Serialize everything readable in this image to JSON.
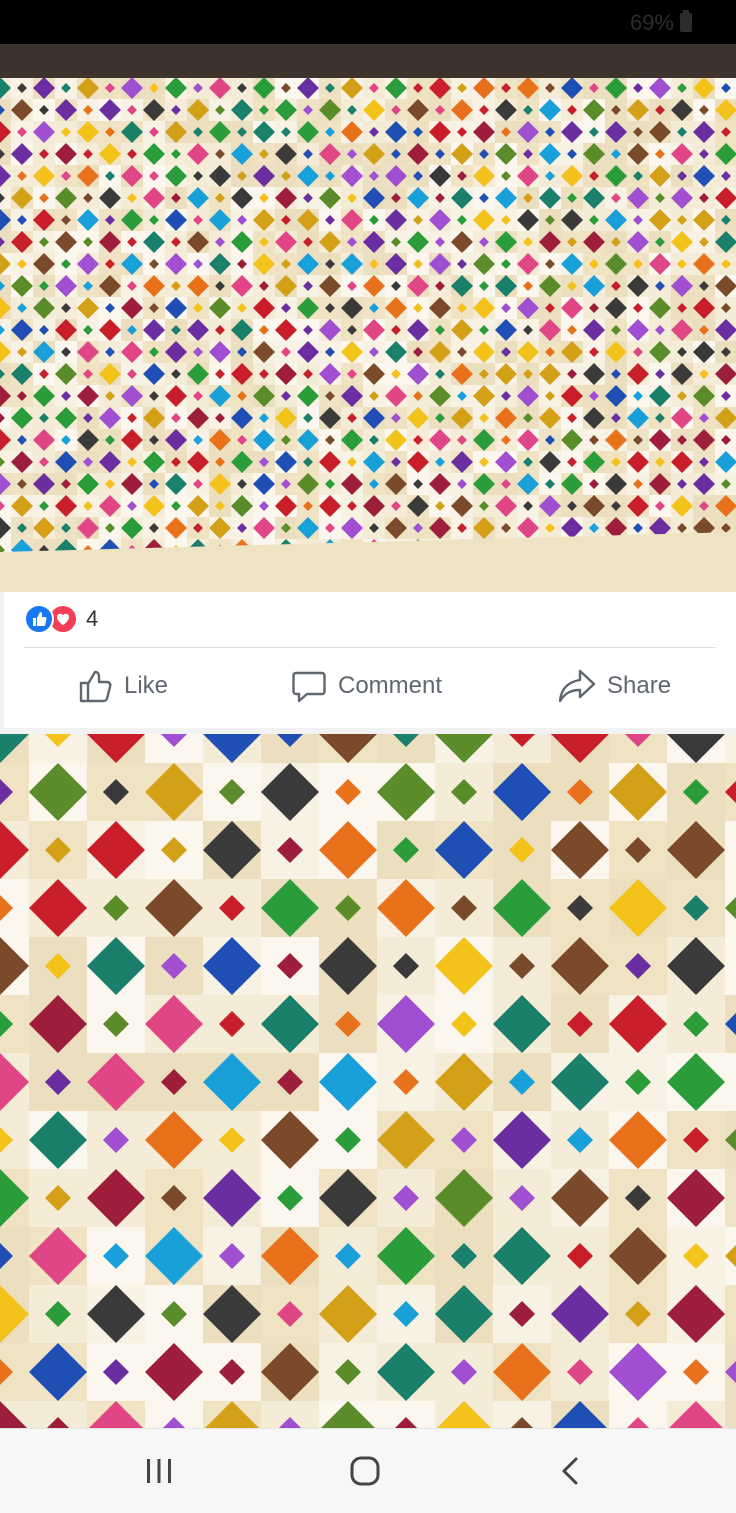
{
  "status_bar": {
    "battery_text": "69%",
    "battery_icon": "battery-icon"
  },
  "photos": [
    {
      "name": "quilt-photo-full",
      "description_icon": "image"
    },
    {
      "name": "quilt-photo-closeup",
      "description_icon": "image"
    }
  ],
  "post": {
    "reactions": {
      "icons": [
        "like-reaction-icon",
        "love-reaction-icon"
      ],
      "count": "4",
      "like_color": "#1877f2",
      "love_color": "#f33e58"
    },
    "actions": {
      "like_label": "Like",
      "comment_label": "Comment",
      "share_label": "Share"
    },
    "text_color": "#606770"
  },
  "nav_bar": {
    "buttons": [
      "recents-icon",
      "home-icon",
      "back-icon"
    ]
  }
}
